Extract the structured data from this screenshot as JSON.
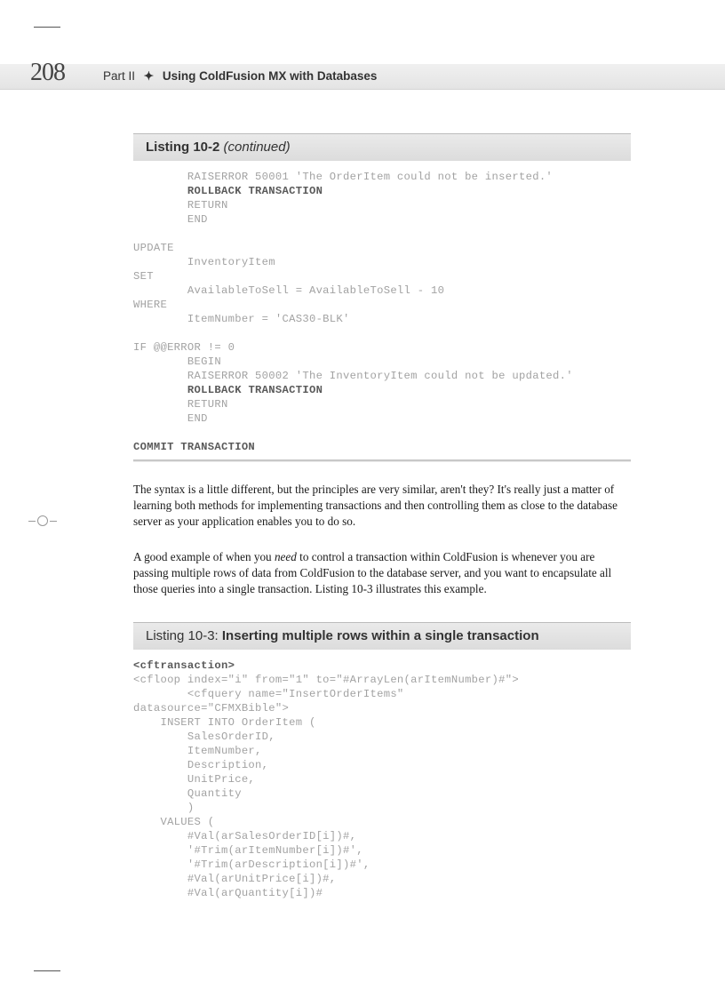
{
  "page_number": "208",
  "header": {
    "part": "Part II",
    "title": "Using ColdFusion MX with Databases"
  },
  "listing_10_2": {
    "label": "Listing 10-2",
    "continued_tag": "(continued)",
    "code_lines": [
      {
        "indent": 2,
        "text": "RAISERROR 50001 'The OrderItem could not be inserted.'"
      },
      {
        "indent": 2,
        "text": "ROLLBACK TRANSACTION",
        "bold": true
      },
      {
        "indent": 2,
        "text": "RETURN"
      },
      {
        "indent": 2,
        "text": "END"
      },
      {
        "indent": 0,
        "text": ""
      },
      {
        "indent": 0,
        "text": "UPDATE"
      },
      {
        "indent": 2,
        "text": "InventoryItem"
      },
      {
        "indent": 0,
        "text": "SET"
      },
      {
        "indent": 2,
        "text": "AvailableToSell = AvailableToSell - 10"
      },
      {
        "indent": 0,
        "text": "WHERE"
      },
      {
        "indent": 2,
        "text": "ItemNumber = 'CAS30-BLK'"
      },
      {
        "indent": 0,
        "text": ""
      },
      {
        "indent": 0,
        "text": "IF @@ERROR != 0"
      },
      {
        "indent": 2,
        "text": "BEGIN"
      },
      {
        "indent": 2,
        "text": "RAISERROR 50002 'The InventoryItem could not be updated.'"
      },
      {
        "indent": 2,
        "text": "ROLLBACK TRANSACTION",
        "bold": true
      },
      {
        "indent": 2,
        "text": "RETURN"
      },
      {
        "indent": 2,
        "text": "END"
      },
      {
        "indent": 0,
        "text": ""
      },
      {
        "indent": 0,
        "text": "COMMIT TRANSACTION",
        "bold": true
      }
    ]
  },
  "paragraphs": {
    "p1": "The syntax is a little different, but the principles are very similar, aren't they? It's really just a matter of learning both methods for implementing transactions and then controlling them as close to the database server as your application enables you to do so.",
    "p2_pre": "A good example of when you ",
    "p2_em": "need",
    "p2_post": " to control a transaction within ColdFusion is whenever you are passing multiple rows of data from ColdFusion to the database server, and you want to encapsulate all those queries into a single transaction. Listing 10-3 illustrates this example."
  },
  "listing_10_3": {
    "label": "Listing 10-3:",
    "title": "Inserting multiple rows within a single transaction",
    "code_lines": [
      {
        "indent": 0,
        "text": "<cftransaction>",
        "bold": true
      },
      {
        "indent": 0,
        "text": "<cfloop index=\"i\" from=\"1\" to=\"#ArrayLen(arItemNumber)#\">"
      },
      {
        "indent": 2,
        "text": "<cfquery name=\"InsertOrderItems\""
      },
      {
        "indent": 0,
        "text": "datasource=\"CFMXBible\">"
      },
      {
        "indent": 1,
        "text": "INSERT INTO OrderItem ("
      },
      {
        "indent": 2,
        "text": "SalesOrderID,"
      },
      {
        "indent": 2,
        "text": "ItemNumber,"
      },
      {
        "indent": 2,
        "text": "Description,"
      },
      {
        "indent": 2,
        "text": "UnitPrice,"
      },
      {
        "indent": 2,
        "text": "Quantity"
      },
      {
        "indent": 2,
        "text": ")"
      },
      {
        "indent": 1,
        "text": "VALUES ("
      },
      {
        "indent": 2,
        "text": "#Val(arSalesOrderID[i])#,"
      },
      {
        "indent": 2,
        "text": "'#Trim(arItemNumber[i])#',"
      },
      {
        "indent": 2,
        "text": "'#Trim(arDescription[i])#',"
      },
      {
        "indent": 2,
        "text": "#Val(arUnitPrice[i])#,"
      },
      {
        "indent": 2,
        "text": "#Val(arQuantity[i])#"
      }
    ]
  }
}
